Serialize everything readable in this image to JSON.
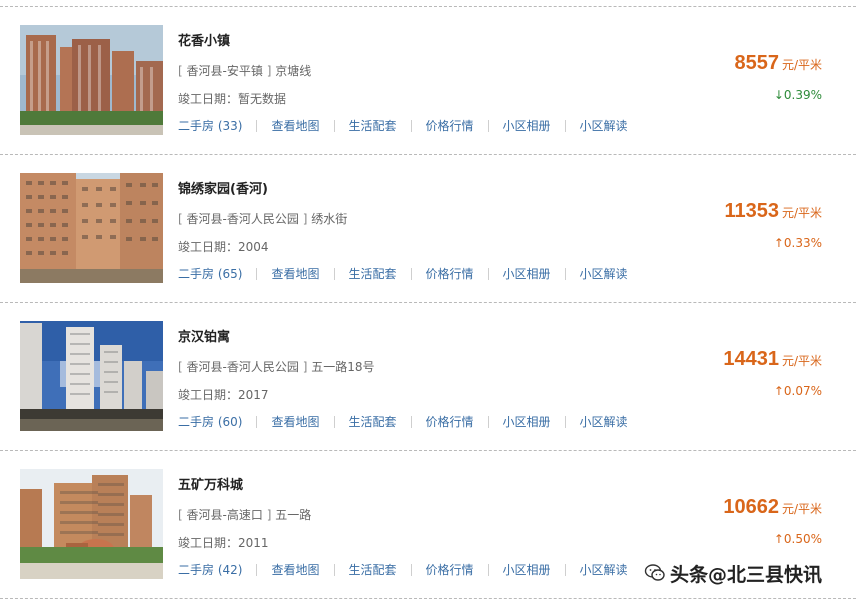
{
  "listings": [
    {
      "name": "花香小镇",
      "addr_open": "[",
      "district": "香河县-安平镇",
      "addr_close": "]",
      "street": "京塘线",
      "date_label": "竣工日期：",
      "date_value": "暂无数据",
      "secondhand_label": "二手房",
      "secondhand_count": "(33)",
      "links": [
        "查看地图",
        "生活配套",
        "价格行情",
        "小区相册",
        "小区解读"
      ],
      "price": "8557",
      "unit": "元/平米",
      "change": "↓0.39%",
      "trend": "down"
    },
    {
      "name": "锦绣家园(香河)",
      "addr_open": "[",
      "district": "香河县-香河人民公园",
      "addr_close": "]",
      "street": "绣水街",
      "date_label": "竣工日期：",
      "date_value": "2004",
      "secondhand_label": "二手房",
      "secondhand_count": "(65)",
      "links": [
        "查看地图",
        "生活配套",
        "价格行情",
        "小区相册",
        "小区解读"
      ],
      "price": "11353",
      "unit": "元/平米",
      "change": "↑0.33%",
      "trend": "up"
    },
    {
      "name": "京汉铂寓",
      "addr_open": "[",
      "district": "香河县-香河人民公园",
      "addr_close": "]",
      "street": "五一路18号",
      "date_label": "竣工日期：",
      "date_value": "2017",
      "secondhand_label": "二手房",
      "secondhand_count": "(60)",
      "links": [
        "查看地图",
        "生活配套",
        "价格行情",
        "小区相册",
        "小区解读"
      ],
      "price": "14431",
      "unit": "元/平米",
      "change": "↑0.07%",
      "trend": "up"
    },
    {
      "name": "五矿万科城",
      "addr_open": "[",
      "district": "香河县-高速口",
      "addr_close": "]",
      "street": "五一路",
      "date_label": "竣工日期：",
      "date_value": "2011",
      "secondhand_label": "二手房",
      "secondhand_count": "(42)",
      "links": [
        "查看地图",
        "生活配套",
        "价格行情",
        "小区相册",
        "小区解读"
      ],
      "price": "10662",
      "unit": "元/平米",
      "change": "↑0.50%",
      "trend": "up"
    }
  ],
  "watermark": {
    "text": "头条@北三县快讯",
    "icon": "wechat-icon"
  },
  "colors": {
    "price": "#d9661a",
    "link": "#3a6ea5",
    "down": "#2e8b3a",
    "up": "#d9661a"
  }
}
